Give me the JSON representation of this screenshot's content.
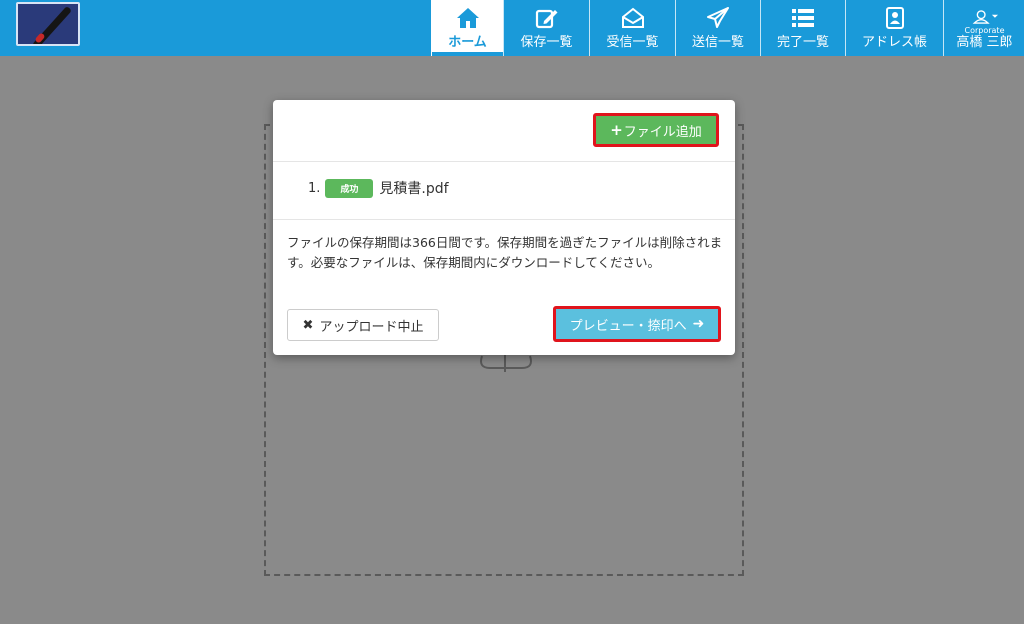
{
  "nav": {
    "logo_alt": "",
    "items": [
      {
        "label": "ホーム",
        "icon": "home-icon",
        "active": true
      },
      {
        "label": "保存一覧",
        "icon": "edit-icon"
      },
      {
        "label": "受信一覧",
        "icon": "envelope-icon"
      },
      {
        "label": "送信一覧",
        "icon": "send-icon"
      },
      {
        "label": "完了一覧",
        "icon": "list-icon"
      },
      {
        "label": "アドレス帳",
        "icon": "address-book-icon"
      }
    ],
    "user": {
      "sub": "Corporate",
      "name": "高橋 三郎",
      "icon": "user-icon"
    }
  },
  "modal": {
    "add_button": "ファイル追加",
    "files": [
      {
        "index": "1.",
        "status": "成功",
        "name": "見積書.pdf"
      }
    ],
    "notice": "ファイルの保存期間は366日間です。保存期間を過ぎたファイルは削除されます。必要なファイルは、保存期間内にダウンロードしてください。",
    "cancel_button": "アップロード中止",
    "preview_button": "プレビュー・捺印へ"
  },
  "colors": {
    "nav_bg": "#1a9ad9",
    "success": "#5cb85c",
    "info": "#5bc0de",
    "highlight": "#e0141c"
  }
}
